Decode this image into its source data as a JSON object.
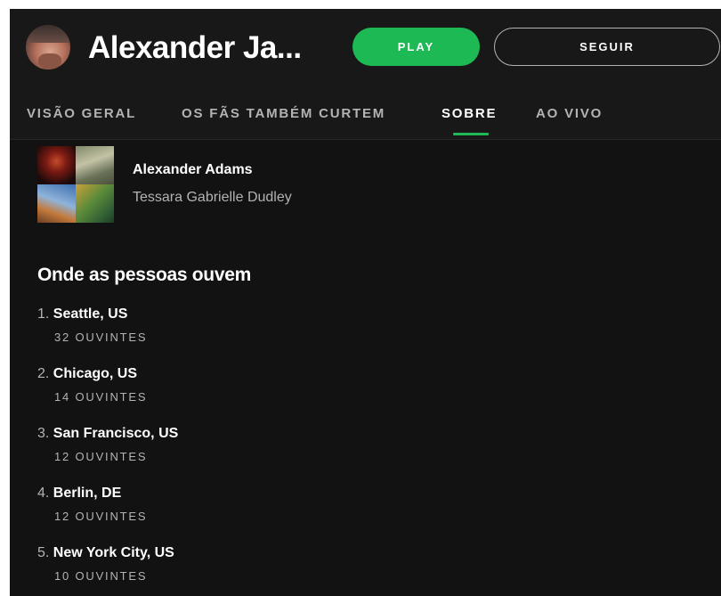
{
  "header": {
    "artist_name": "Alexander Ja...",
    "play_label": "PLAY",
    "follow_label": "SEGUIR"
  },
  "tabs": [
    {
      "label": "VISÃO GERAL",
      "active": false
    },
    {
      "label": "OS FÃS TAMBÉM CURTEM",
      "active": false
    },
    {
      "label": "SOBRE",
      "active": true
    },
    {
      "label": "AO VIVO",
      "active": false
    }
  ],
  "feature": {
    "name": "Alexander Adams",
    "subtitle": "Tessara Gabrielle Dudley"
  },
  "where_people_listen": {
    "title": "Onde as pessoas ouvem",
    "cities": [
      {
        "rank": "1.",
        "city": "Seattle, US",
        "listeners": "32 OUVINTES"
      },
      {
        "rank": "2.",
        "city": "Chicago, US",
        "listeners": "14 OUVINTES"
      },
      {
        "rank": "3.",
        "city": "San Francisco, US",
        "listeners": "12 OUVINTES"
      },
      {
        "rank": "4.",
        "city": "Berlin, DE",
        "listeners": "12 OUVINTES"
      },
      {
        "rank": "5.",
        "city": "New York City, US",
        "listeners": "10 OUVINTES"
      }
    ]
  },
  "colors": {
    "accent": "#1db954",
    "header_bg": "#181818",
    "content_bg": "#121212",
    "text_primary": "#ffffff",
    "text_secondary": "#b3b3b3"
  }
}
